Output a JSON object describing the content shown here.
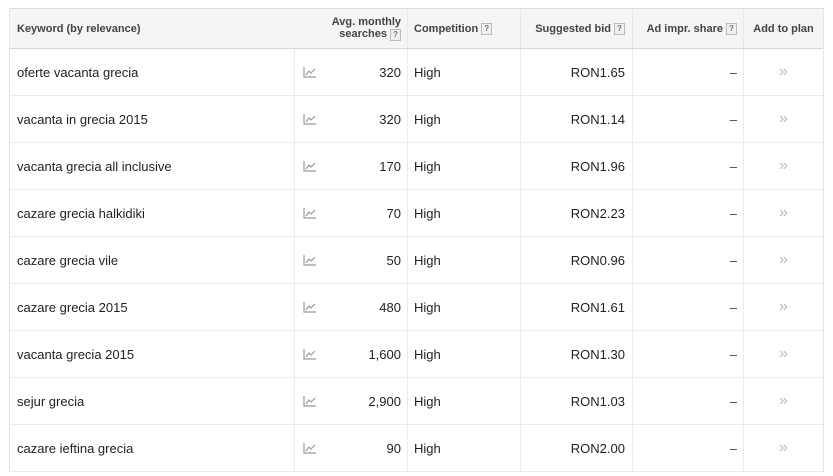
{
  "header": {
    "keyword": "Keyword (by relevance)",
    "avg_line1": "Avg. monthly",
    "avg_line2": "searches",
    "competition": "Competition",
    "suggested_bid": "Suggested bid",
    "ad_impr_share": "Ad impr. share",
    "add_to_plan": "Add to plan",
    "help_glyph": "?"
  },
  "rows": [
    {
      "keyword": "oferte vacanta grecia",
      "searches": "320",
      "competition": "High",
      "bid": "RON1.65",
      "impr": "–",
      "add": "»"
    },
    {
      "keyword": "vacanta in grecia 2015",
      "searches": "320",
      "competition": "High",
      "bid": "RON1.14",
      "impr": "–",
      "add": "»"
    },
    {
      "keyword": "vacanta grecia all inclusive",
      "searches": "170",
      "competition": "High",
      "bid": "RON1.96",
      "impr": "–",
      "add": "»"
    },
    {
      "keyword": "cazare grecia halkidiki",
      "searches": "70",
      "competition": "High",
      "bid": "RON2.23",
      "impr": "–",
      "add": "»"
    },
    {
      "keyword": "cazare grecia vile",
      "searches": "50",
      "competition": "High",
      "bid": "RON0.96",
      "impr": "–",
      "add": "»"
    },
    {
      "keyword": "cazare grecia 2015",
      "searches": "480",
      "competition": "High",
      "bid": "RON1.61",
      "impr": "–",
      "add": "»"
    },
    {
      "keyword": "vacanta grecia 2015",
      "searches": "1,600",
      "competition": "High",
      "bid": "RON1.30",
      "impr": "–",
      "add": "»"
    },
    {
      "keyword": "sejur grecia",
      "searches": "2,900",
      "competition": "High",
      "bid": "RON1.03",
      "impr": "–",
      "add": "»"
    },
    {
      "keyword": "cazare ieftina grecia",
      "searches": "90",
      "competition": "High",
      "bid": "RON2.00",
      "impr": "–",
      "add": "»"
    }
  ],
  "icons": {
    "trend": "trend-chart-icon",
    "help": "help-icon",
    "add": "add-to-plan-icon"
  }
}
